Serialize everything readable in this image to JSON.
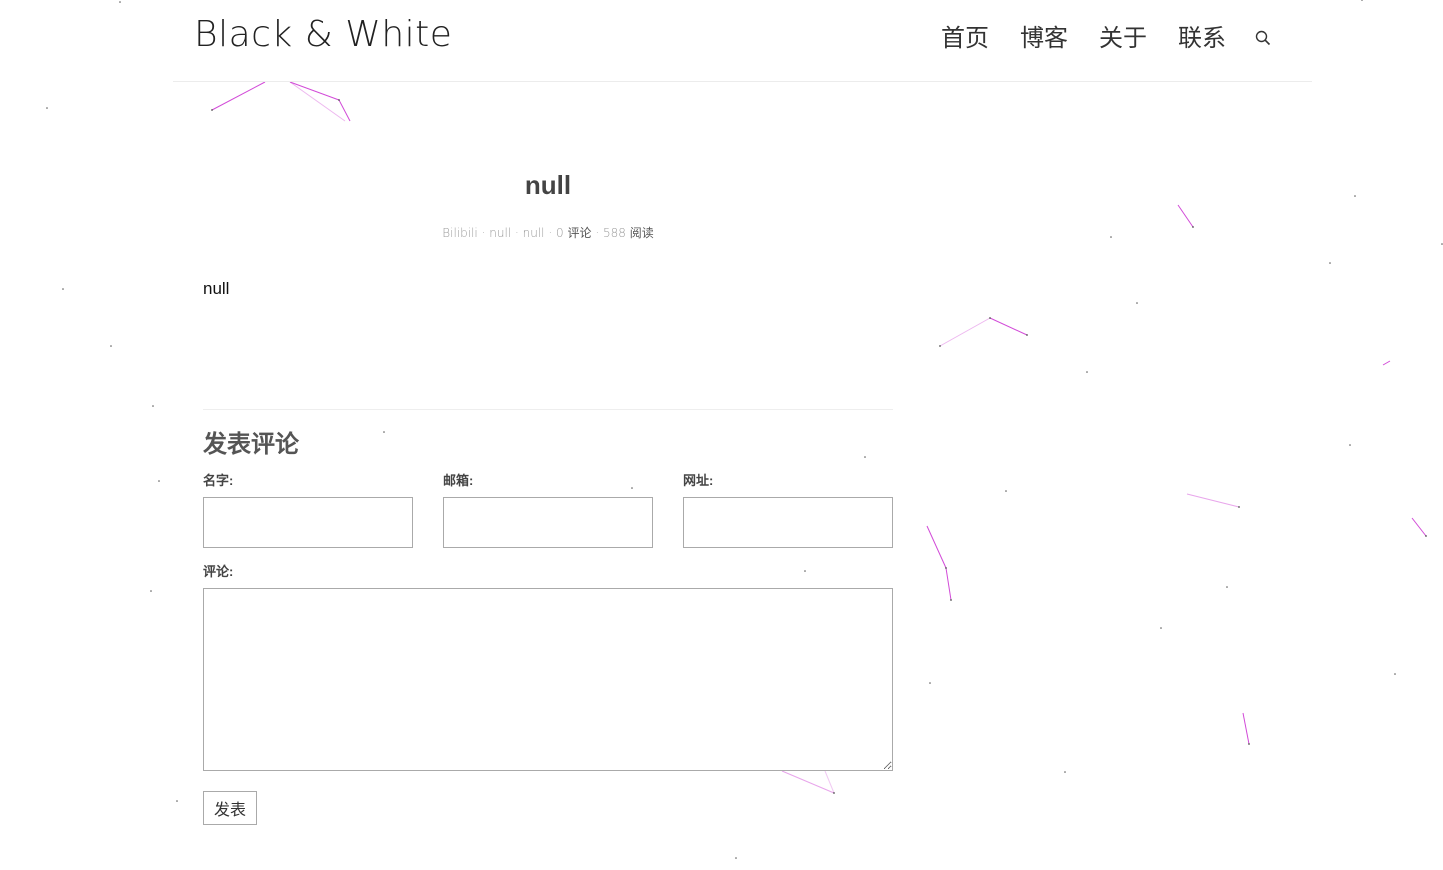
{
  "header": {
    "brand": "Black & White",
    "nav": [
      {
        "label": "首页"
      },
      {
        "label": "博客"
      },
      {
        "label": "关于"
      },
      {
        "label": "联系"
      }
    ],
    "search_icon": "search-icon"
  },
  "post": {
    "title": "null",
    "meta": {
      "source": "Bilibili",
      "sep": "·",
      "field1": "null",
      "field2": "null",
      "comment_count": "0",
      "comment_label": "评论",
      "views": "588",
      "views_label": "阅读"
    },
    "body": "null"
  },
  "comment_form": {
    "title": "发表评论",
    "name_label": "名字:",
    "email_label": "邮箱:",
    "url_label": "网址:",
    "comment_label": "评论:",
    "name_value": "",
    "email_value": "",
    "url_value": "",
    "comment_value": "",
    "submit_label": "发表"
  },
  "colors": {
    "background": "#ffffff",
    "particle_line": "#d24bd8",
    "particle_dot": "#555555",
    "header_border": "#ececec"
  }
}
